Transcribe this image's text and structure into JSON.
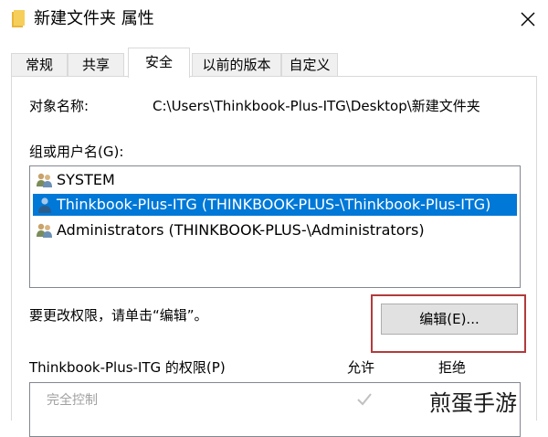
{
  "window": {
    "title": "新建文件夹 属性",
    "icon": "folder-icon",
    "close_icon": "close-icon"
  },
  "tabs": [
    {
      "label": "常规",
      "active": false
    },
    {
      "label": "共享",
      "active": false
    },
    {
      "label": "安全",
      "active": true
    },
    {
      "label": "以前的版本",
      "active": false
    },
    {
      "label": "自定义",
      "active": false
    }
  ],
  "security": {
    "object_name_label": "对象名称:",
    "object_name_value": "C:\\Users\\Thinkbook-Plus-ITG\\Desktop\\新建文件夹",
    "groups_label": "组或用户名(G):",
    "groups": [
      {
        "name": "SYSTEM",
        "icon": "user-group-icon",
        "selected": false
      },
      {
        "name": "Thinkbook-Plus-ITG (THINKBOOK-PLUS-\\Thinkbook-Plus-ITG)",
        "icon": "user-icon",
        "selected": true
      },
      {
        "name": "Administrators (THINKBOOK-PLUS-\\Administrators)",
        "icon": "user-group-icon",
        "selected": false
      }
    ],
    "change_perm_text": "要更改权限，请单击“编辑”。",
    "edit_button": "编辑(E)...",
    "perm_for_label": "Thinkbook-Plus-ITG 的权限(P)",
    "allow_header": "允许",
    "deny_header": "拒绝",
    "permissions": [
      {
        "name": "完全控制",
        "allow": true,
        "deny": false
      }
    ]
  },
  "colors": {
    "selection": "#0078d7",
    "highlight_box": "#b23b3b"
  },
  "watermark": "煎蛋手游"
}
